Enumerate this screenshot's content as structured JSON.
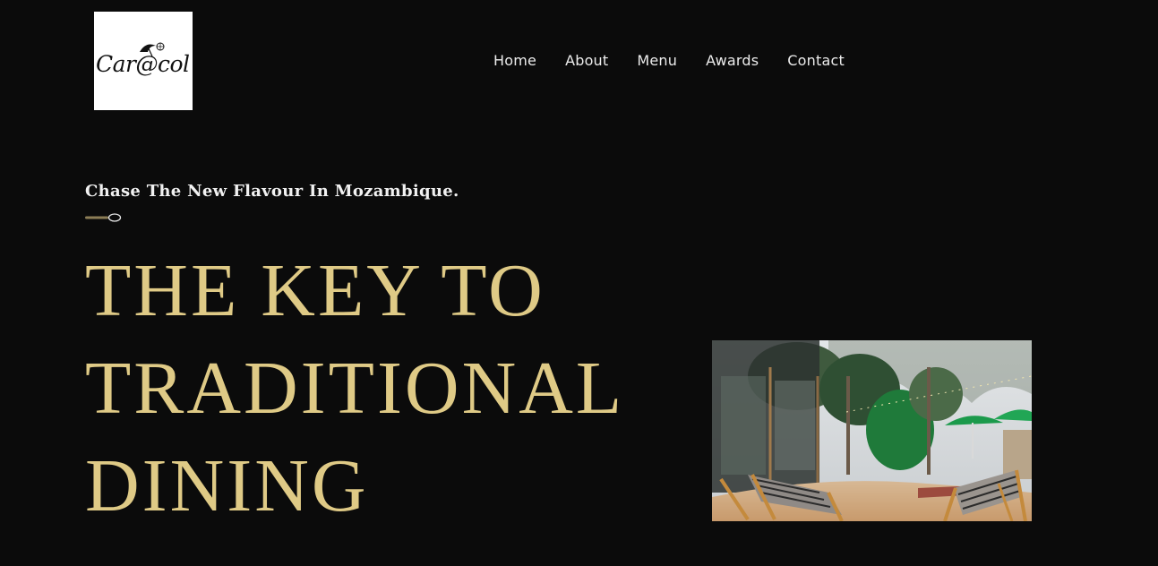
{
  "logo": {
    "text": "Car@col",
    "icon": "beach-umbrella-icon"
  },
  "nav": {
    "items": [
      {
        "label": "Home"
      },
      {
        "label": "About"
      },
      {
        "label": "Menu"
      },
      {
        "label": "Awards"
      },
      {
        "label": "Contact"
      }
    ]
  },
  "hero": {
    "tagline": "Chase The New Flavour In Mozambique.",
    "divider_icon": "spoon-icon",
    "title_lines": [
      "THE KEY TO",
      "TRADITIONAL",
      "DINING"
    ],
    "image_subject": "restaurant-patio-photo"
  },
  "colors": {
    "background": "#0b0b0b",
    "accent_gold": "#dfca86",
    "nav_text": "#ececec",
    "logo_bg": "#ffffff"
  }
}
